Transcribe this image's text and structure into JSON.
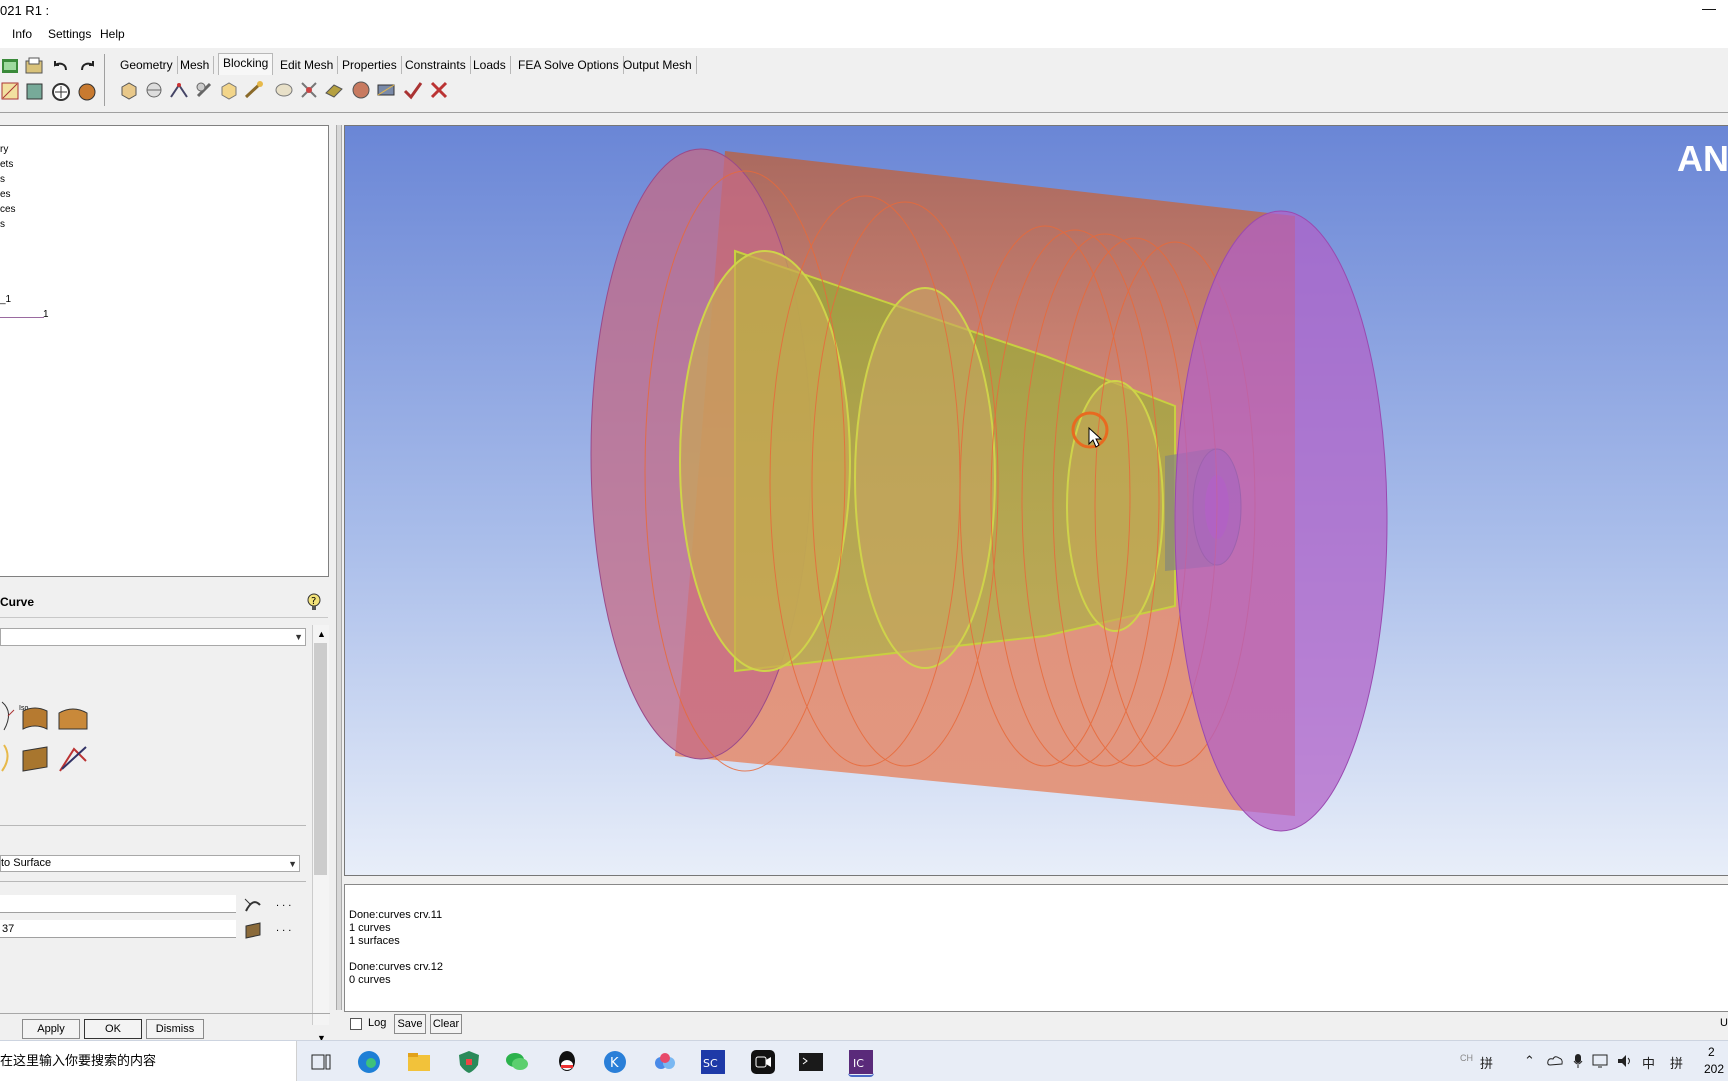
{
  "window": {
    "title": "021 R1 :",
    "minimize_glyph": "—"
  },
  "menu": [
    "Info",
    "Settings",
    "Help"
  ],
  "tabs": [
    "Geometry",
    "Mesh",
    "Blocking",
    "Edit Mesh",
    "Properties",
    "Constraints",
    "Loads",
    "FEA Solve Options",
    "Output Mesh"
  ],
  "active_tab": "Blocking",
  "tree": {
    "items": [
      "ry",
      "ets",
      "s",
      "es",
      "ces",
      "s",
      "_1"
    ],
    "sub_item": "1"
  },
  "panel": {
    "title": "Curve",
    "method_select": "to Surface",
    "field1_value": "",
    "field2_value": "37",
    "ellipsis": ". . .",
    "iso_label": "Iso",
    "buttons": {
      "apply": "Apply",
      "ok": "OK",
      "dismiss": "Dismiss"
    }
  },
  "viewport": {
    "logo_text": "AN"
  },
  "log": {
    "lines": [
      "Done:curves crv.11",
      "1 curves",
      "1 surfaces",
      "",
      "Done:curves crv.12",
      "0 curves"
    ],
    "log_label": "Log",
    "save_label": "Save",
    "clear_label": "Clear",
    "right_cutoff": "U"
  },
  "taskbar": {
    "search_placeholder": "在这里输入你要搜索的内容",
    "tray_ime": "中",
    "tray_kbd": "拼",
    "tray_lang": "CH",
    "clock": "2",
    "date": "202"
  },
  "colors": {
    "outer_cylinder": "#e8896a",
    "end_cap": "#b25fc7",
    "inner_part": "#c9c152",
    "background_top": "#6a86d6"
  }
}
